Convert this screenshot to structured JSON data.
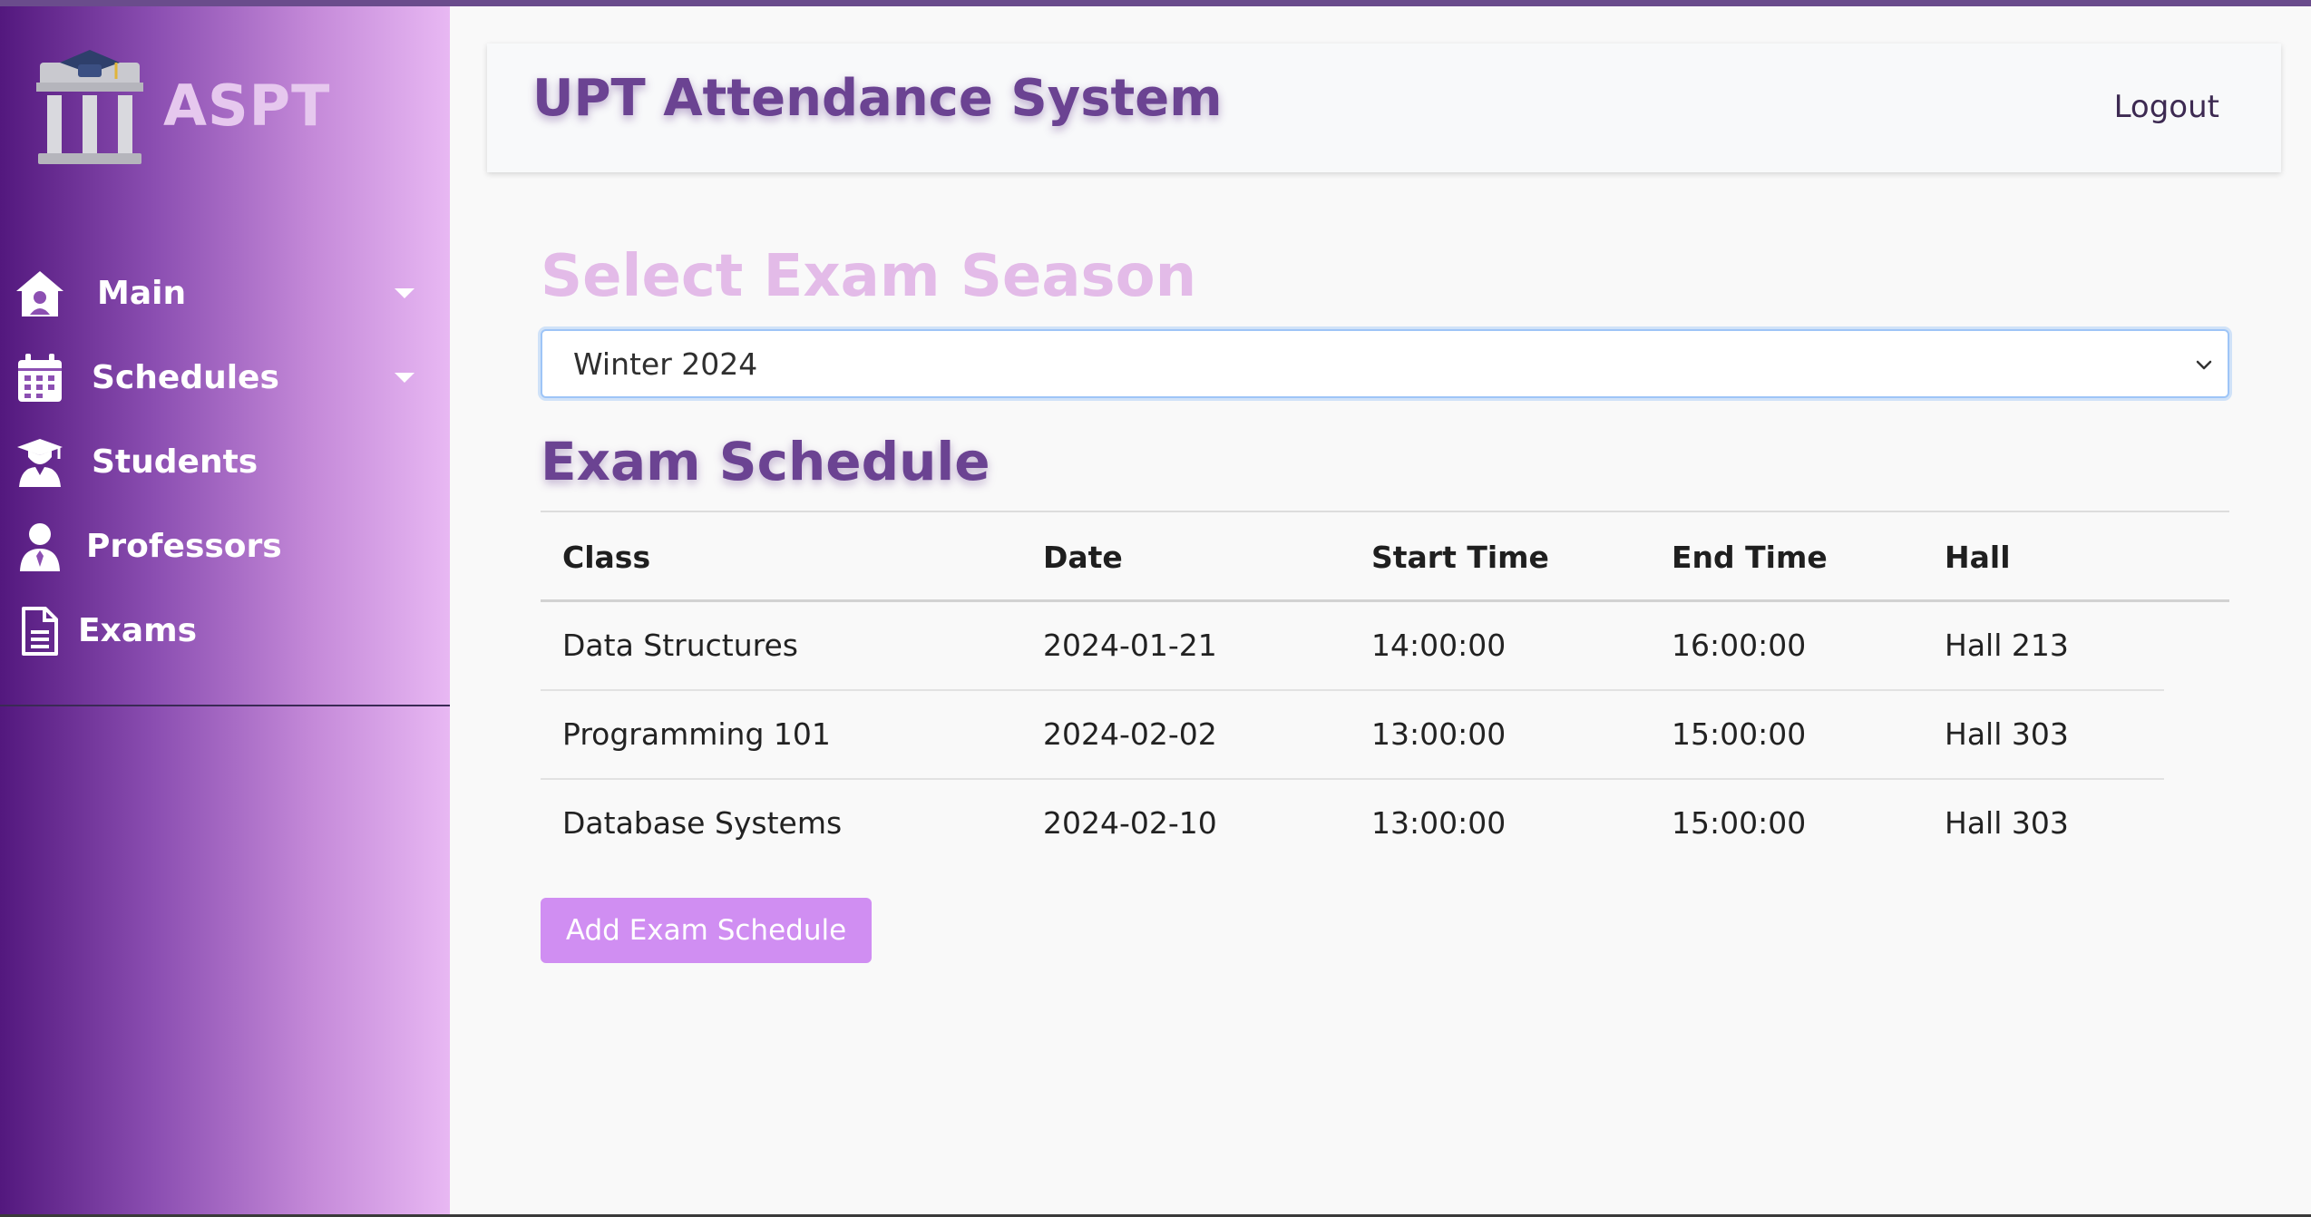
{
  "brand": {
    "name": "ASPT"
  },
  "sidebar": {
    "items": [
      {
        "label": "Main",
        "icon": "home-icon",
        "has_caret": true
      },
      {
        "label": "Schedules",
        "icon": "calendar-icon",
        "has_caret": true
      },
      {
        "label": "Students",
        "icon": "student-icon",
        "has_caret": false
      },
      {
        "label": "Professors",
        "icon": "user-icon",
        "has_caret": false
      },
      {
        "label": "Exams",
        "icon": "document-icon",
        "has_caret": false
      }
    ]
  },
  "header": {
    "title": "UPT Attendance System",
    "logout_label": "Logout"
  },
  "season": {
    "heading": "Select Exam Season",
    "selected": "Winter 2024"
  },
  "schedule": {
    "heading": "Exam Schedule",
    "columns": [
      "Class",
      "Date",
      "Start Time",
      "End Time",
      "Hall"
    ],
    "rows": [
      [
        "Data Structures",
        "2024-01-21",
        "14:00:00",
        "16:00:00",
        "Hall 213"
      ],
      [
        "Programming 101",
        "2024-02-02",
        "13:00:00",
        "15:00:00",
        "Hall 303"
      ],
      [
        "Database Systems",
        "2024-02-10",
        "13:00:00",
        "15:00:00",
        "Hall 303"
      ]
    ],
    "add_button_label": "Add Exam Schedule"
  },
  "colors": {
    "accent_purple": "#6b4392",
    "light_purple_heading": "#e3bbe8",
    "button_purple": "#d08ef2",
    "sidebar_dark": "#53187e",
    "sidebar_light": "#e8b8f3"
  }
}
